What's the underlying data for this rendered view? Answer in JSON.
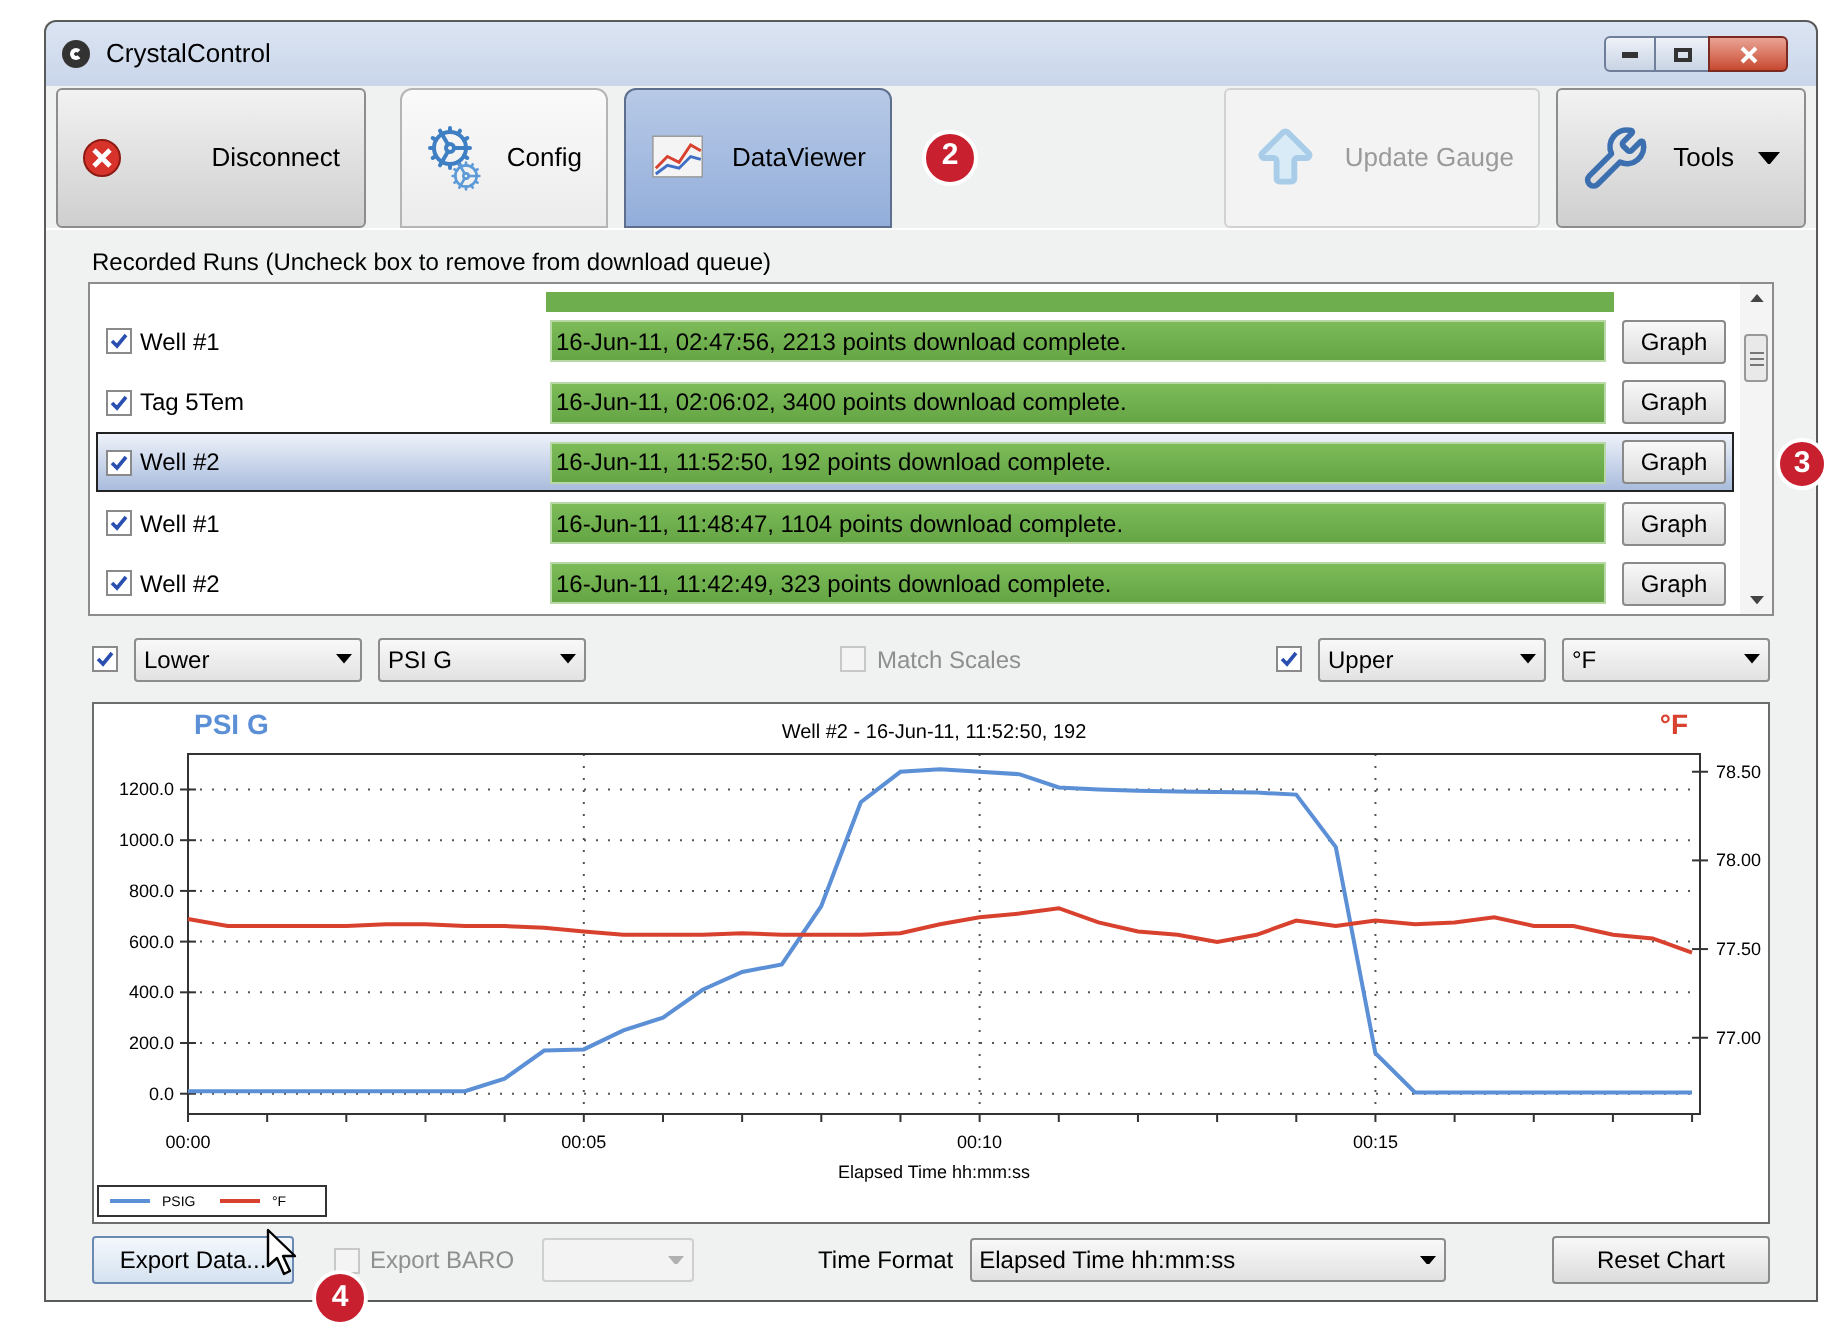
{
  "window": {
    "title": "CrystalControl"
  },
  "toolbar": {
    "left_buttons": [
      {
        "label": "Disconnect",
        "kind": "disconnect",
        "selected": false,
        "disabled": false
      },
      {
        "label": "Config",
        "kind": "config",
        "selected": false,
        "disabled": false
      },
      {
        "label": "DataViewer",
        "kind": "viewer",
        "selected": true,
        "disabled": false
      }
    ],
    "callout": "2",
    "right_buttons": [
      {
        "label": "Update Gauge",
        "kind": "update",
        "selected": false,
        "disabled": true
      },
      {
        "label": "Tools",
        "kind": "tools",
        "selected": false,
        "disabled": false
      }
    ]
  },
  "run_list": {
    "caption": "Recorded Runs (Uncheck box to remove from download queue)",
    "rows": [
      {
        "name": "Well #1",
        "checked": true,
        "status": "16-Jun-11, 02:47:56, 2213 points download complete.",
        "selected": false,
        "button": "Graph"
      },
      {
        "name": "Tag 5Tem",
        "checked": true,
        "status": "16-Jun-11, 02:06:02, 3400 points download complete.",
        "selected": false,
        "button": "Graph"
      },
      {
        "name": "Well #2",
        "checked": true,
        "status": "16-Jun-11, 11:52:50, 192 points download complete.",
        "selected": true,
        "button": "Graph"
      },
      {
        "name": "Well #1",
        "checked": true,
        "status": "16-Jun-11, 11:48:47, 1104 points download complete.",
        "selected": false,
        "button": "Graph"
      },
      {
        "name": "Well #2",
        "checked": true,
        "status": "16-Jun-11, 11:42:49, 323 points download complete.",
        "selected": false,
        "button": "Graph"
      }
    ],
    "callout": "3"
  },
  "chart_controls": {
    "lower": {
      "checked": true,
      "position": "Lower",
      "unit": "PSI G"
    },
    "match_scales": {
      "label": "Match Scales",
      "checked": false,
      "disabled": true
    },
    "upper": {
      "checked": true,
      "position": "Upper",
      "unit": "°F"
    }
  },
  "chart": {
    "chart_data": {
      "type": "line",
      "title": "Well #2 - 16-Jun-11, 11:52:50, 192",
      "xlabel": "Elapsed Time hh:mm:ss",
      "ylabel": "PSI G",
      "y2label": "°F",
      "y2lim": [
        76.57,
        78.6
      ],
      "y2ticks": [
        {
          "value": 77,
          "label": "77.00"
        },
        {
          "value": 77.5,
          "label": "77.50"
        },
        {
          "value": 78,
          "label": "78.00"
        },
        {
          "value": 78.5,
          "label": "78.50"
        }
      ],
      "x": [
        0,
        0.5,
        1,
        1.5,
        2,
        2.5,
        3,
        3.5,
        4,
        4.5,
        5,
        5.5,
        6,
        6.5,
        7,
        7.5,
        8,
        8.5,
        9,
        9.5,
        10,
        10.5,
        11,
        11.5,
        12,
        12.5,
        13,
        13.5,
        14,
        14.5,
        15,
        15.5,
        16,
        16.5,
        17,
        17.5,
        18,
        18.5,
        19
      ],
      "series": [
        {
          "name": "PSIG",
          "color": "#5b8fd6",
          "values": [
            10,
            10,
            10,
            10,
            10,
            10,
            10,
            10,
            60,
            170,
            175,
            250,
            300,
            410,
            480,
            510,
            740,
            1150,
            1270,
            1280,
            1270,
            1260,
            1208,
            1200,
            1195,
            1192,
            1190,
            1188,
            1180,
            973,
            160,
            5,
            5,
            5,
            5,
            5,
            5,
            5,
            5
          ]
        },
        {
          "name": "°F",
          "color": "#d9412f",
          "axis": "y2",
          "values": [
            77.67,
            77.63,
            77.63,
            77.63,
            77.63,
            77.64,
            77.64,
            77.63,
            77.63,
            77.62,
            77.6,
            77.58,
            77.58,
            77.58,
            77.59,
            77.58,
            77.58,
            77.58,
            77.59,
            77.64,
            77.68,
            77.7,
            77.73,
            77.65,
            77.6,
            77.58,
            77.54,
            77.58,
            77.66,
            77.63,
            77.66,
            77.64,
            77.65,
            77.68,
            77.63,
            77.63,
            77.58,
            77.56,
            77.48
          ]
        }
      ],
      "grid": true,
      "legend": "lower left",
      "xlim": [
        0,
        19.1
      ],
      "ylim": [
        -80,
        1340
      ],
      "xticks": [
        {
          "value": 0,
          "label": "00:00"
        },
        {
          "value": 5,
          "label": "00:05"
        },
        {
          "value": 10,
          "label": "00:10"
        },
        {
          "value": 15,
          "label": "00:15"
        }
      ],
      "yticks": [
        {
          "value": 0,
          "label": "0.0"
        },
        {
          "value": 200,
          "label": "200.0"
        },
        {
          "value": 400,
          "label": "400.0"
        },
        {
          "value": 600,
          "label": "600.0"
        },
        {
          "value": 800,
          "label": "800.0"
        },
        {
          "value": 1000,
          "label": "1000.0"
        },
        {
          "value": 1200,
          "label": "1200.0"
        }
      ]
    }
  },
  "footer": {
    "export_button": "Export Data...",
    "export_baro": {
      "label": "Export BARO",
      "checked": false,
      "disabled": true
    },
    "baro_select": {
      "disabled": true
    },
    "time_format_label": "Time Format",
    "time_format_value": "Elapsed Time hh:mm:ss",
    "reset_button": "Reset Chart",
    "callout": "4"
  }
}
